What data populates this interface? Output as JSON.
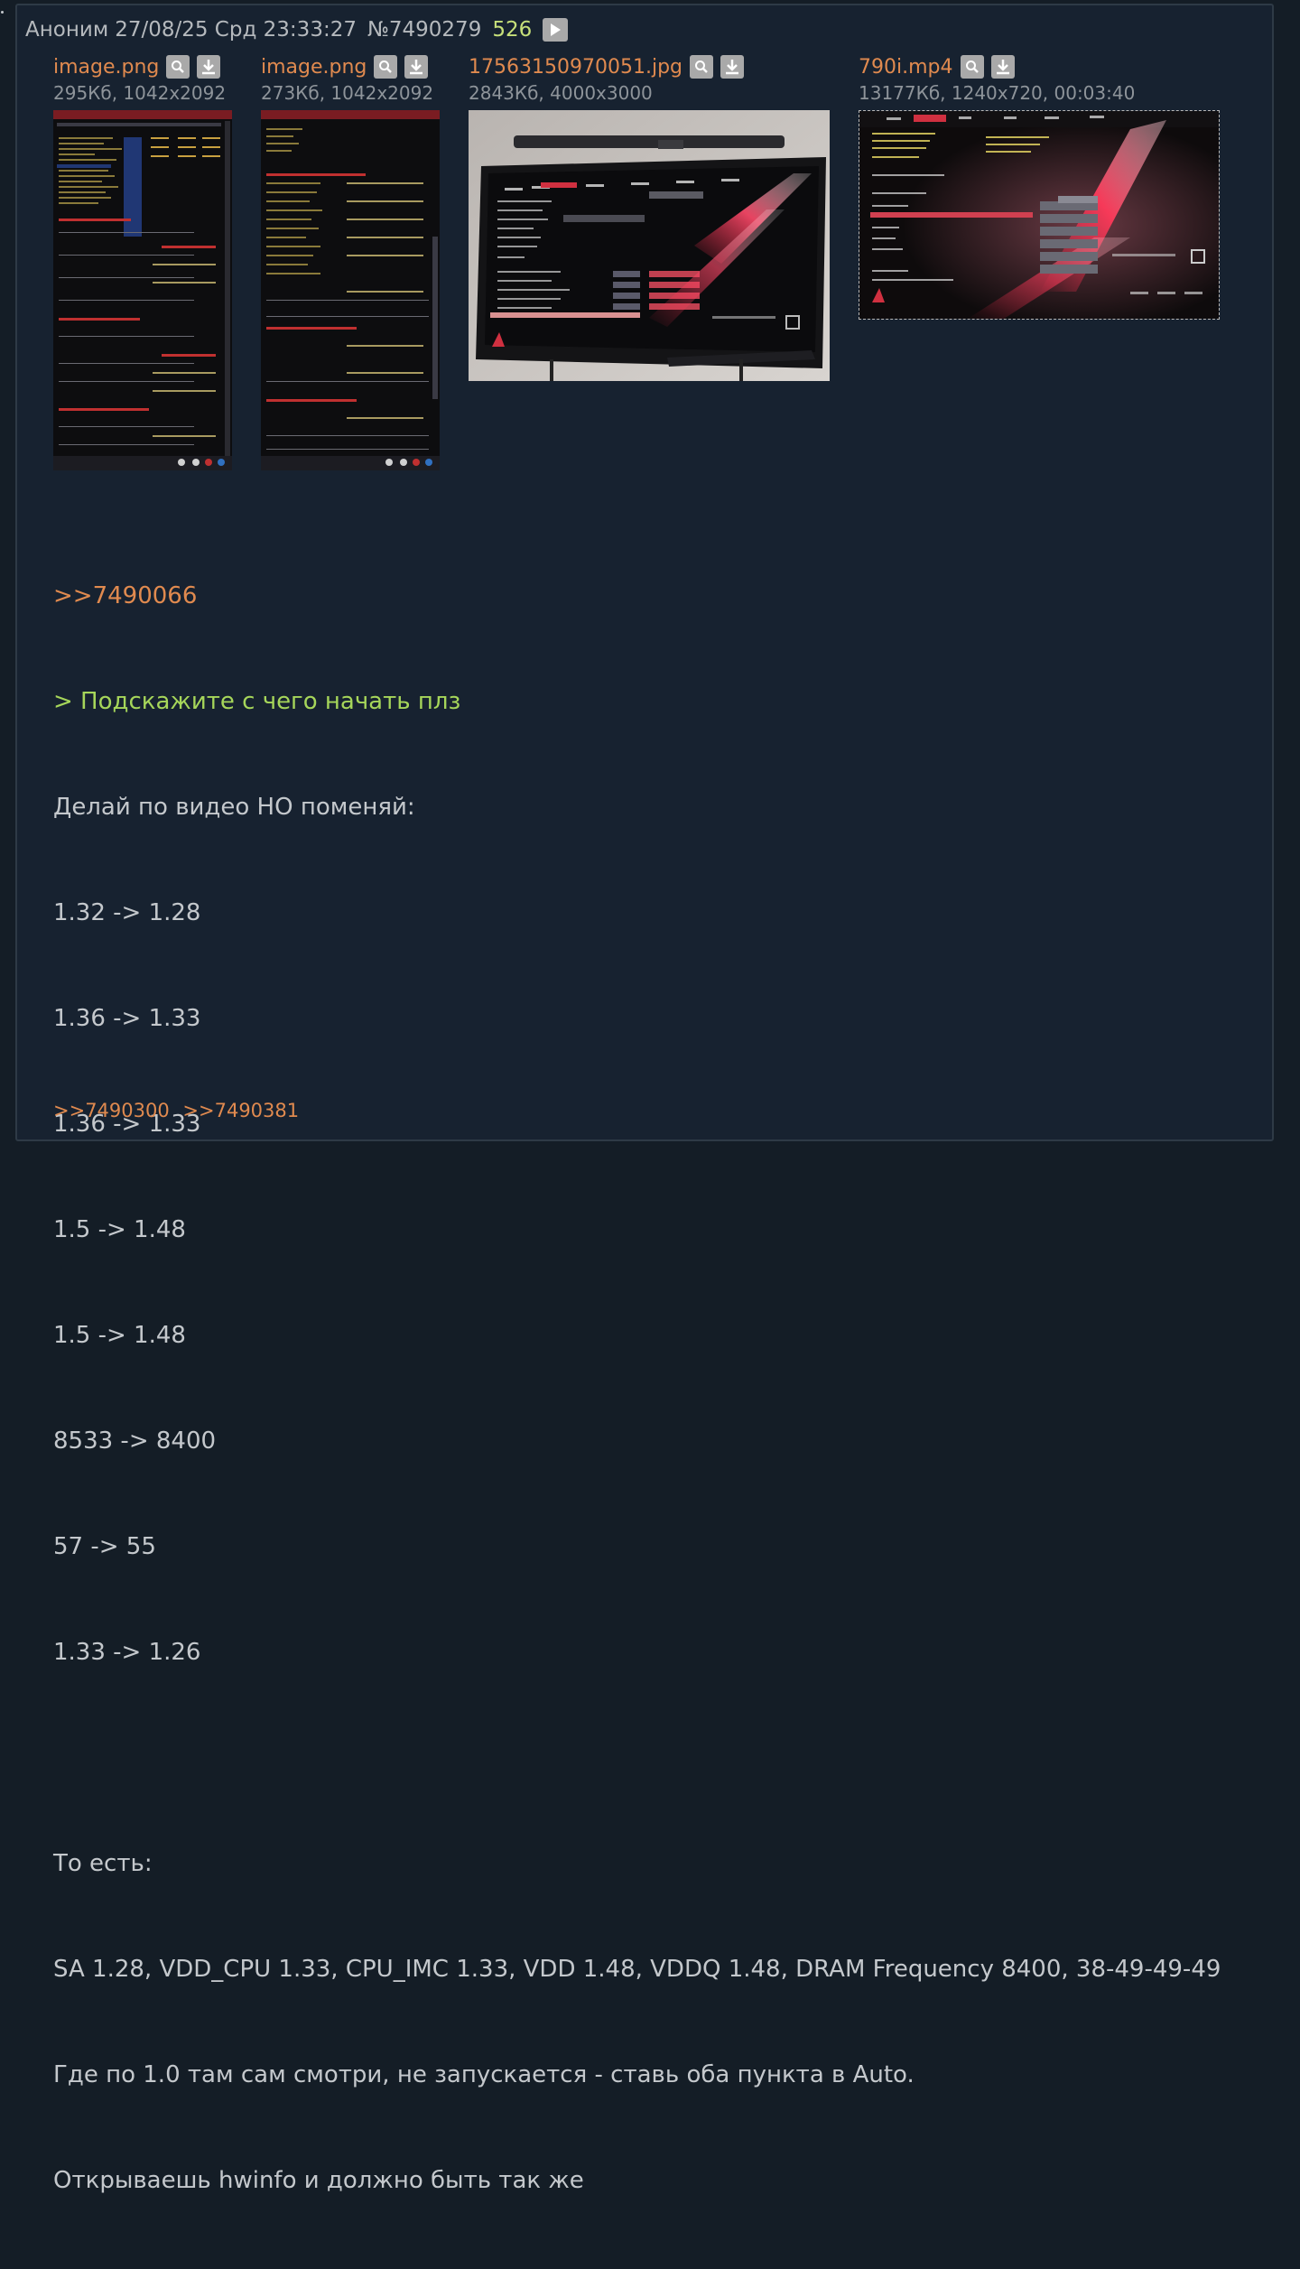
{
  "header": {
    "name": "Аноним",
    "date": "27/08/25 Срд 23:33:27",
    "num": "№7490279",
    "count": "526"
  },
  "files": [
    {
      "name": "image.png",
      "meta": "295Кб, 1042x2092"
    },
    {
      "name": "image.png",
      "meta": "273Кб, 1042x2092"
    },
    {
      "name": "17563150970051.jpg",
      "meta": "2843Кб, 4000x3000"
    },
    {
      "name": "790i.mp4",
      "meta": "13177Кб, 1240x720, 00:03:40"
    }
  ],
  "body": {
    "reply_link": ">>7490066",
    "quote": "> Подскажите с чего начать плз",
    "lines": [
      "Делай по видео НО поменяй:",
      "1.32 -> 1.28",
      "1.36 -> 1.33",
      "1.36 -> 1.33",
      "1.5 -> 1.48",
      "1.5 -> 1.48",
      "8533 -> 8400",
      "57 -> 55",
      "1.33 -> 1.26"
    ],
    "lines2": [
      "То есть:",
      "SA 1.28, VDD_CPU 1.33, CPU_IMC 1.33, VDD 1.48, VDDQ 1.48, DRAM Frequency 8400, 38-49-49-49",
      "Где по 1.0 там сам смотри, не запускается - ставь оба пункта в Auto.",
      "Открываешь hwinfo и должно быть так же"
    ]
  },
  "replies": [
    ">>7490300",
    ">>7490381"
  ]
}
